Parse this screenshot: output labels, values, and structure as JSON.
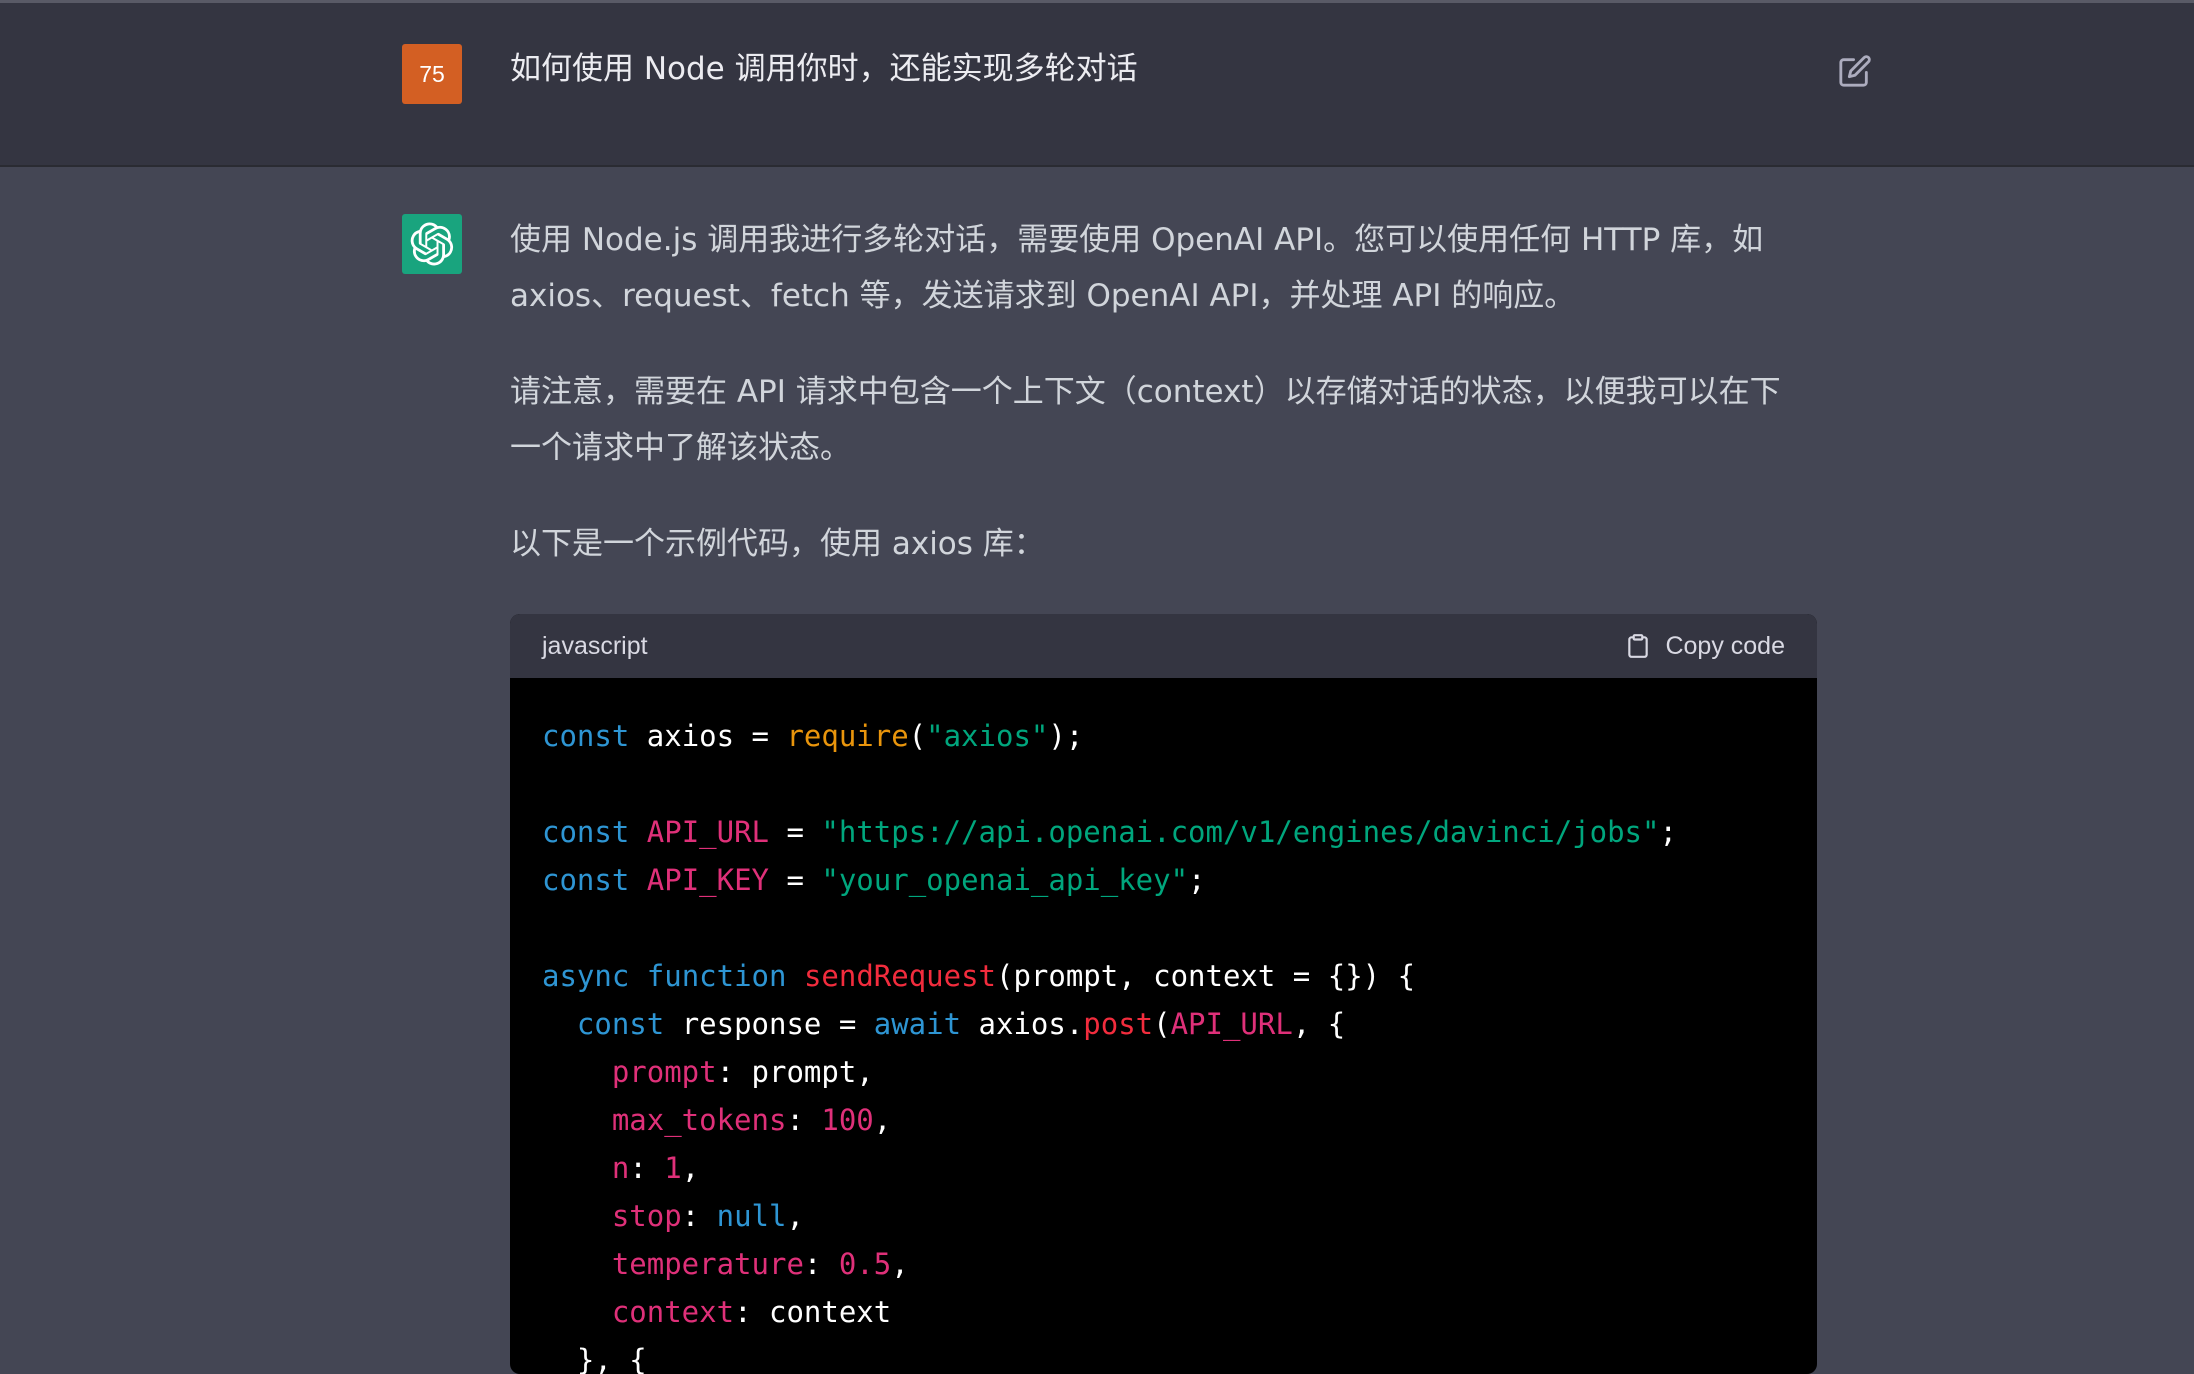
{
  "user": {
    "avatar_text": "75",
    "question": "如何使用 Node 调用你时，还能实现多轮对话"
  },
  "assistant": {
    "paragraphs": [
      "使用 Node.js 调用我进行多轮对话，需要使用 OpenAI API。您可以使用任何 HTTP 库，如",
      "axios、request、fetch 等，发送请求到 OpenAI API，并处理 API 的响应。",
      "请注意，需要在 API 请求中包含一个上下文（context）以存储对话的状态，以便我可以在下",
      "一个请求中了解该状态。",
      "以下是一个示例代码，使用 axios 库："
    ],
    "code": {
      "language": "javascript",
      "copy_label": "Copy code",
      "lines": [
        [
          [
            "kw",
            "const"
          ],
          [
            "pl",
            " axios = "
          ],
          [
            "fy",
            "require"
          ],
          [
            "pl",
            "("
          ],
          [
            "str",
            "\"axios\""
          ],
          [
            "pl",
            ");"
          ]
        ],
        [],
        [
          [
            "kw",
            "const"
          ],
          [
            "pl",
            " "
          ],
          [
            "prop",
            "API_URL"
          ],
          [
            "pl",
            " = "
          ],
          [
            "str",
            "\"https://api.openai.com/v1/engines/davinci/jobs\""
          ],
          [
            "pl",
            ";"
          ]
        ],
        [
          [
            "kw",
            "const"
          ],
          [
            "pl",
            " "
          ],
          [
            "prop",
            "API_KEY"
          ],
          [
            "pl",
            " = "
          ],
          [
            "str",
            "\"your_openai_api_key\""
          ],
          [
            "pl",
            ";"
          ]
        ],
        [],
        [
          [
            "kw",
            "async"
          ],
          [
            "pl",
            " "
          ],
          [
            "kw",
            "function"
          ],
          [
            "pl",
            " "
          ],
          [
            "fn",
            "sendRequest"
          ],
          [
            "pl",
            "(prompt, context = {}) {"
          ]
        ],
        [
          [
            "pl",
            "  "
          ],
          [
            "kw",
            "const"
          ],
          [
            "pl",
            " response = "
          ],
          [
            "kw",
            "await"
          ],
          [
            "pl",
            " axios."
          ],
          [
            "fn",
            "post"
          ],
          [
            "pl",
            "("
          ],
          [
            "prop",
            "API_URL"
          ],
          [
            "pl",
            ", {"
          ]
        ],
        [
          [
            "pl",
            "    "
          ],
          [
            "prop",
            "prompt"
          ],
          [
            "pl",
            ": prompt,"
          ]
        ],
        [
          [
            "pl",
            "    "
          ],
          [
            "prop",
            "max_tokens"
          ],
          [
            "pl",
            ": "
          ],
          [
            "num",
            "100"
          ],
          [
            "pl",
            ","
          ]
        ],
        [
          [
            "pl",
            "    "
          ],
          [
            "prop",
            "n"
          ],
          [
            "pl",
            ": "
          ],
          [
            "num",
            "1"
          ],
          [
            "pl",
            ","
          ]
        ],
        [
          [
            "pl",
            "    "
          ],
          [
            "prop",
            "stop"
          ],
          [
            "pl",
            ": "
          ],
          [
            "kw",
            "null"
          ],
          [
            "pl",
            ","
          ]
        ],
        [
          [
            "pl",
            "    "
          ],
          [
            "prop",
            "temperature"
          ],
          [
            "pl",
            ": "
          ],
          [
            "num",
            "0.5"
          ],
          [
            "pl",
            ","
          ]
        ],
        [
          [
            "pl",
            "    "
          ],
          [
            "prop",
            "context"
          ],
          [
            "pl",
            ": context"
          ]
        ],
        [
          [
            "pl",
            "  }, {"
          ]
        ]
      ]
    }
  },
  "icons": {
    "edit": "edit-icon",
    "openai_logo": "openai-logo-icon",
    "clipboard": "clipboard-icon"
  },
  "colors": {
    "page_bg": "#444654",
    "user_row_bg": "#343541",
    "user_avatar": "#d35f23",
    "gpt_avatar": "#19a47e",
    "code_bg": "#000000",
    "code_header_bg": "#343541"
  }
}
